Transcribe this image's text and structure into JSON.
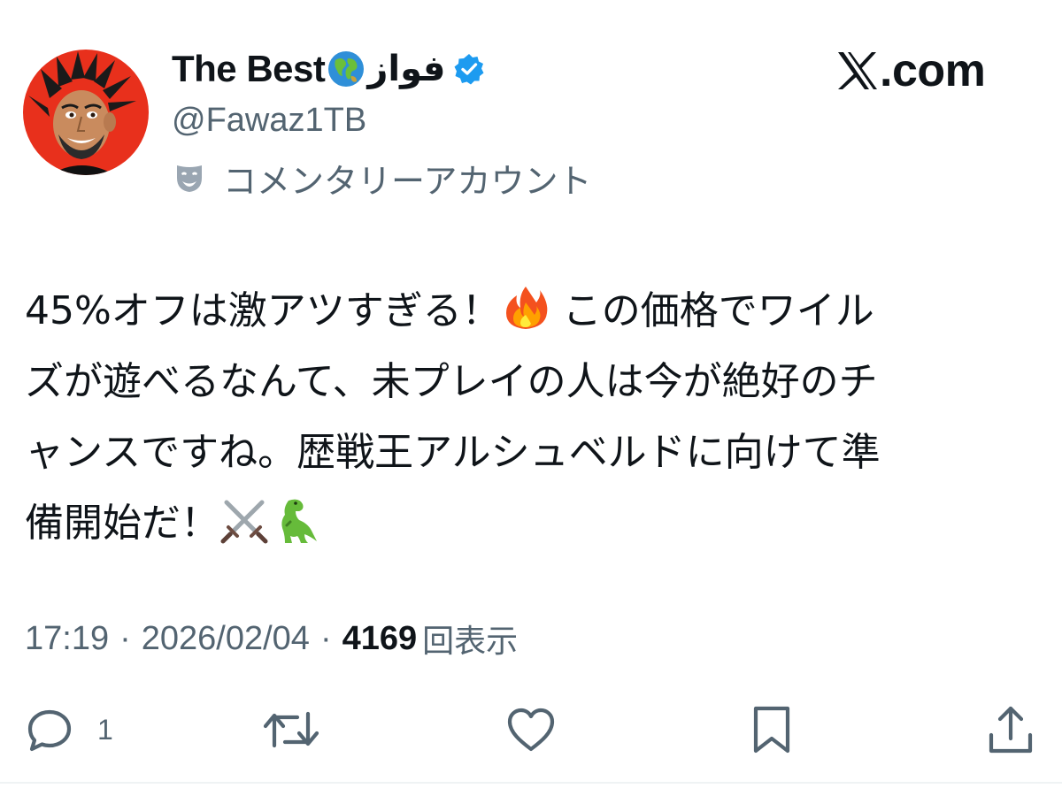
{
  "author": {
    "display_name": "The Best",
    "display_name_arabic": "فواز",
    "globe_emoji": "globe-emoji",
    "handle": "@Fawaz1TB",
    "verified": true,
    "verified_color": "#1d9bf0",
    "account_type_icon": "theater-mask-icon",
    "account_type_label": "コメンタリーアカウント"
  },
  "brand": {
    "logo": "x-logo-icon",
    "text": ".com"
  },
  "tweet": {
    "line1_text": "45%オフは激アツすぎる！",
    "line1_emoji": "fire-emoji",
    "line1_rest": " この価格でワイル",
    "line2": "ズが遊べるなんて、未プレイの人は今が絶好のチ",
    "line3": "ャンスですね。歴戦王アルシュベルドに向けて準",
    "line4_text": "備開始だ！",
    "line4_emojis": [
      "crossed-swords-emoji",
      "t-rex-emoji"
    ]
  },
  "meta": {
    "time": "17:19",
    "separator": "·",
    "date": "2026/02/04",
    "view_count": "4169",
    "views_label": "回表示"
  },
  "actions": {
    "reply_count": "1",
    "icons": [
      "reply-icon",
      "retweet-icon",
      "like-icon",
      "bookmark-icon",
      "share-icon"
    ],
    "icon_color": "#536471"
  }
}
